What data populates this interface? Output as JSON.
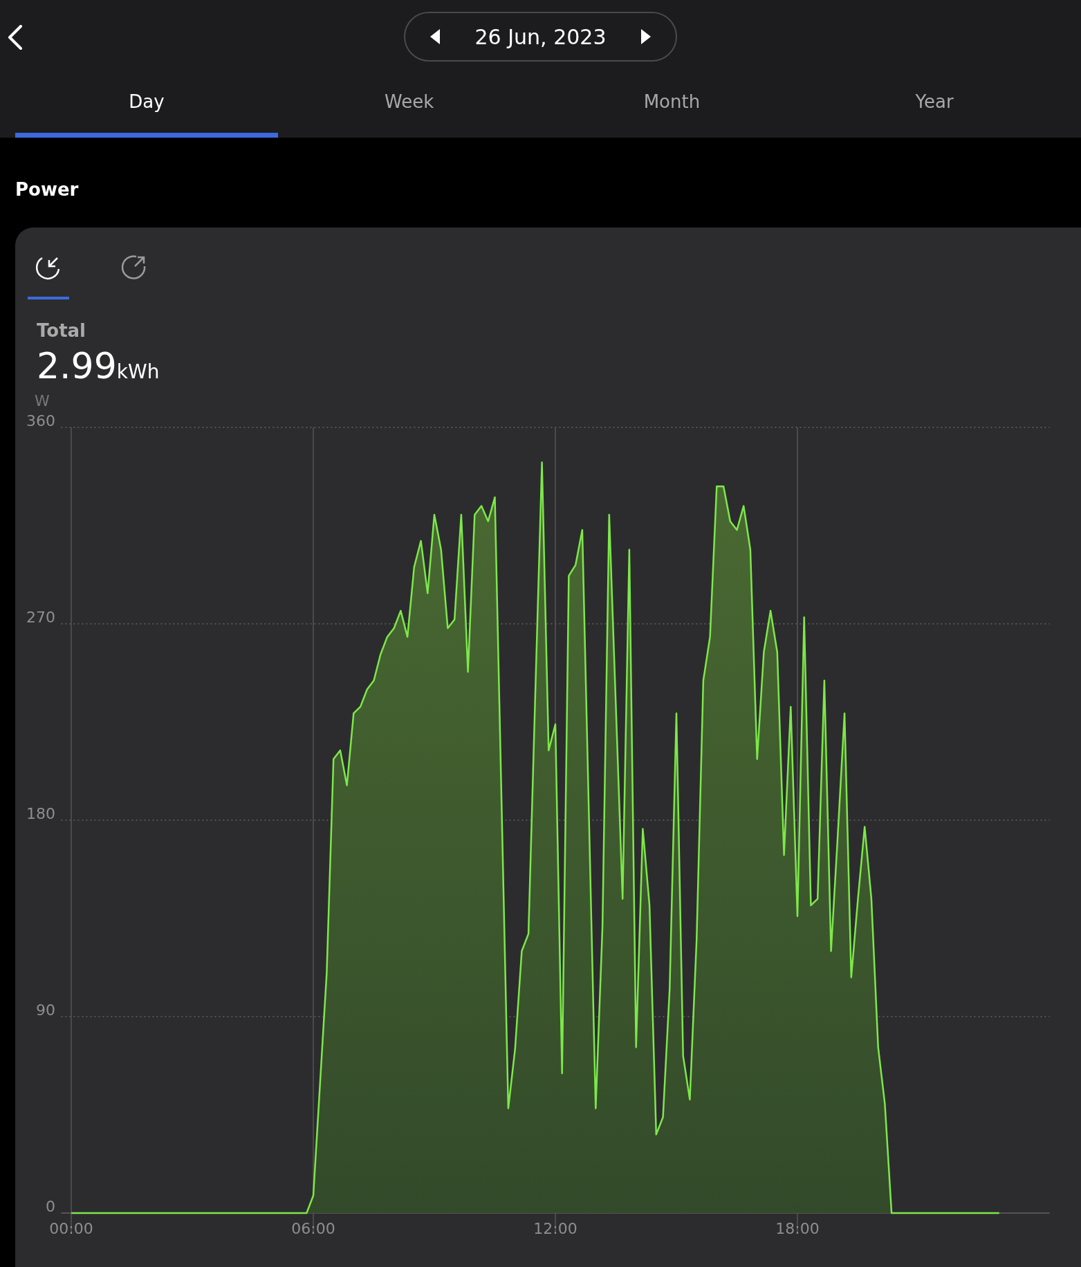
{
  "header": {
    "date": "26 Jun, 2023"
  },
  "tabs": [
    {
      "label": "Day",
      "selected": true
    },
    {
      "label": "Week",
      "selected": false
    },
    {
      "label": "Month",
      "selected": false
    },
    {
      "label": "Year",
      "selected": false
    }
  ],
  "section_title": "Power",
  "card": {
    "flow_tabs": [
      {
        "kind": "import",
        "selected": true
      },
      {
        "kind": "export",
        "selected": false
      }
    ],
    "total_label": "Total",
    "total_value": "2.99",
    "total_unit": "kWh",
    "chart_data": {
      "type": "area",
      "ylabel": "W",
      "grid": true,
      "x": [
        0,
        350,
        360,
        370,
        380,
        390,
        400,
        410,
        420,
        430,
        440,
        450,
        460,
        470,
        480,
        490,
        500,
        510,
        520,
        530,
        540,
        550,
        560,
        570,
        580,
        590,
        600,
        610,
        620,
        630,
        640,
        650,
        660,
        670,
        680,
        690,
        700,
        710,
        720,
        730,
        740,
        750,
        760,
        770,
        780,
        790,
        800,
        810,
        820,
        830,
        840,
        850,
        860,
        870,
        880,
        890,
        900,
        910,
        920,
        930,
        940,
        950,
        960,
        970,
        980,
        990,
        1000,
        1010,
        1020,
        1030,
        1040,
        1050,
        1060,
        1070,
        1080,
        1090,
        1100,
        1110,
        1120,
        1130,
        1140,
        1150,
        1160,
        1170,
        1180,
        1190,
        1200,
        1210,
        1220,
        1380
      ],
      "series": [
        {
          "color": "#7de84a",
          "values": [
            0,
            0,
            8,
            59,
            110,
            208,
            212,
            196,
            229,
            232,
            240,
            244,
            256,
            264,
            268,
            276,
            264,
            296,
            308,
            284,
            320,
            304,
            268,
            272,
            320,
            248,
            320,
            324,
            317,
            328,
            188,
            48,
            75,
            120,
            128,
            236,
            344,
            212,
            224,
            64,
            292,
            297,
            313,
            181,
            48,
            131,
            320,
            232,
            144,
            304,
            76,
            176,
            141,
            36,
            44,
            103,
            229,
            72,
            52,
            125,
            244,
            264,
            333,
            333,
            317,
            313,
            324,
            304,
            208,
            257,
            276,
            257,
            164,
            232,
            136,
            273,
            141,
            144,
            244,
            120,
            173,
            229,
            108,
            144,
            177,
            144,
            76,
            50,
            0,
            0
          ]
        }
      ],
      "xlim": [
        -15,
        1455
      ],
      "ylim": [
        0,
        360
      ],
      "xticks": [
        {
          "value": 0,
          "label": "00:00"
        },
        {
          "value": 360,
          "label": "06:00"
        },
        {
          "value": 720,
          "label": "12:00"
        },
        {
          "value": 1080,
          "label": "18:00"
        }
      ],
      "yticks": [
        0,
        90,
        180,
        270,
        360
      ]
    }
  }
}
